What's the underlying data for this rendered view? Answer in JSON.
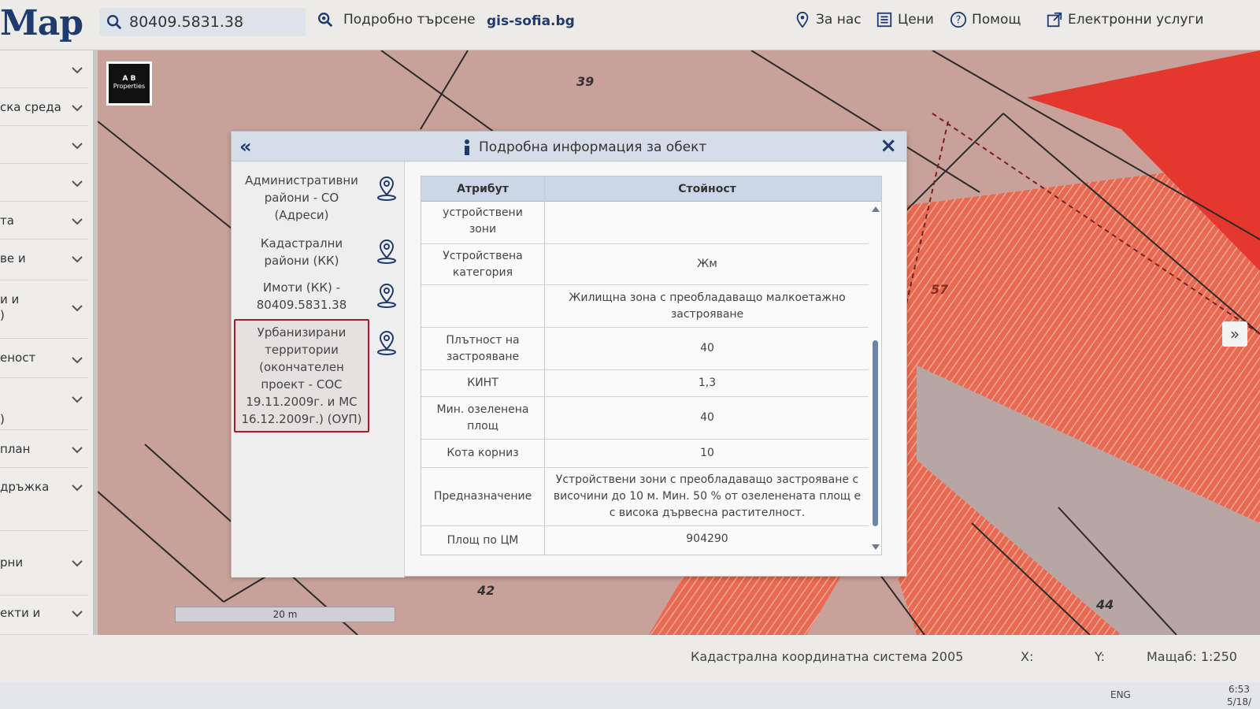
{
  "header": {
    "logo": "Map",
    "search_value": "80409.5831.38",
    "advanced_search": "Подробно търсене",
    "site": "gis-sofia.bg",
    "nav": [
      {
        "label": "За нас",
        "icon": "location-pin-icon"
      },
      {
        "label": "Цени",
        "icon": "price-list-icon"
      },
      {
        "label": "Помощ",
        "icon": "help-icon"
      },
      {
        "label": "Електронни услуги",
        "icon": "external-link-icon"
      }
    ]
  },
  "sidebar": {
    "items": [
      {
        "label": ""
      },
      {
        "label": "ска среда"
      },
      {
        "label": ""
      },
      {
        "label": ""
      },
      {
        "label": "та"
      },
      {
        "label": "ве и"
      },
      {
        "label": "и и\n)"
      },
      {
        "label": "еност"
      },
      {
        "label": "\n)"
      },
      {
        "label": "план"
      },
      {
        "label": "дръжка"
      },
      {
        "label": "рни"
      },
      {
        "label": "екти и"
      }
    ]
  },
  "brand": {
    "line1": "A B",
    "line2": "Properties"
  },
  "map": {
    "labels": [
      "39",
      "57",
      "42",
      "44"
    ],
    "scale_bar": "20 m",
    "expand_icon": "double-chevron-right-icon"
  },
  "dialog": {
    "title": "Подробна информация за обект",
    "back_icon": "double-chevron-left-icon",
    "close_icon": "close-icon",
    "layers": [
      {
        "label": "Административни\nрайони - СО\n(Адреси)",
        "active": false
      },
      {
        "label": "Кадастрални\nрайони (КК)",
        "active": false
      },
      {
        "label": "Имоти (КК) -\n80409.5831.38",
        "active": false
      },
      {
        "label": "Урбанизирани\nтерритории\n(окончателен\nпроект - СОС\n19.11.2009г. и МС\n16.12.2009г.) (ОУП)",
        "active": true
      }
    ],
    "table": {
      "headers": [
        "Атрибут",
        "Стойност"
      ],
      "rows": [
        {
          "key": "устройствени\nзони",
          "value": ""
        },
        {
          "key": "Устройствена\nкатегория",
          "value": "Жм"
        },
        {
          "key": "",
          "value": "Жилищна зона с преобладаващо малкоетажно\nзастрояване"
        },
        {
          "key": "Плътност на\nзастрояване",
          "value": "40"
        },
        {
          "key": "КИНТ",
          "value": "1,3"
        },
        {
          "key": "Мин. озеленена\nплощ",
          "value": "40"
        },
        {
          "key": "Кота корниз",
          "value": "10"
        },
        {
          "key": "Предназначение",
          "value": "Устройствени зони с преобладаващо застрояване с\nвисочини до 10 м. Мин. 50 % от озеленената площ е\nс висока дървесна растителност."
        },
        {
          "key": "Площ по ЦМ",
          "value": "904290"
        }
      ]
    }
  },
  "footer": {
    "coord_system": "Кадастрална координатна система 2005",
    "x_label": "X:",
    "y_label": "Y:",
    "scale": "Мащаб: 1:250"
  },
  "taskbar": {
    "lang": "ENG",
    "time": "6:53",
    "date": "5/18/"
  }
}
